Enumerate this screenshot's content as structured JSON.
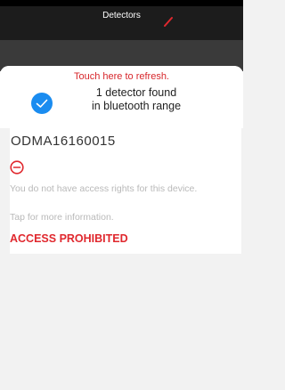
{
  "header": {
    "title": "Detectors",
    "edit_icon": "edit-pencil-icon"
  },
  "scan": {
    "refresh_link": "Touch here to refresh.",
    "status_icon": "check-circle-icon",
    "found_line1": "1 detector found",
    "found_line2": "in bluetooth range"
  },
  "device": {
    "id": "ODMA16160015",
    "status_icon": "prohibited-icon",
    "message": "You do not have access rights for this device.",
    "more_info": "Tap for more information.",
    "access_status": "ACCESS PROHIBITED"
  },
  "colors": {
    "accent_red": "#e0282e",
    "check_blue": "#1a8cf0",
    "header_dark": "#1c1c1c"
  }
}
